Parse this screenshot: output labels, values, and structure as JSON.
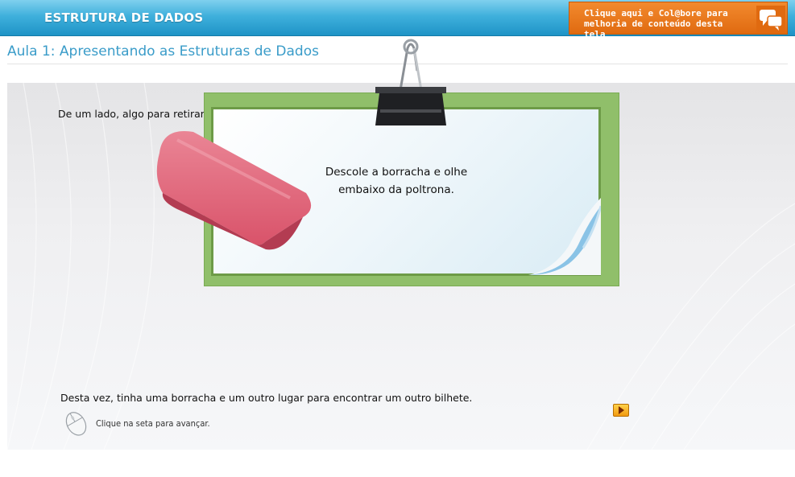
{
  "header": {
    "course_title": "ESTRUTURA DE DADOS",
    "collaborate": {
      "line1": "Clique aqui e Col@bore para",
      "line2": "melhoria de conteúdo desta tela",
      "icon": "speech-bubbles-icon"
    }
  },
  "lesson": {
    "title": "Aula 1: Apresentando as Estruturas de Dados"
  },
  "content": {
    "intro": "De um lado, algo para retirar, um lápis, e, do outro, um novo lugar para encontrar um outro bilhete.",
    "note_line1": "Descole a borracha e olhe",
    "note_line2": "embaixo da poltrona.",
    "outro": "Desta vez, tinha uma borracha e um outro lugar para encontrar um outro bilhete.",
    "hint": "Clique na seta para avançar."
  },
  "colors": {
    "header_blue": "#2fa3d4",
    "collab_orange": "#e8781e",
    "title_blue": "#3a9cc9",
    "board_green": "#90bf6a",
    "eraser_pink": "#d9536a"
  },
  "icons": {
    "mouse": "mouse-icon",
    "next": "play-arrow-icon",
    "clip": "binder-clip-icon",
    "eraser": "eraser-image"
  }
}
